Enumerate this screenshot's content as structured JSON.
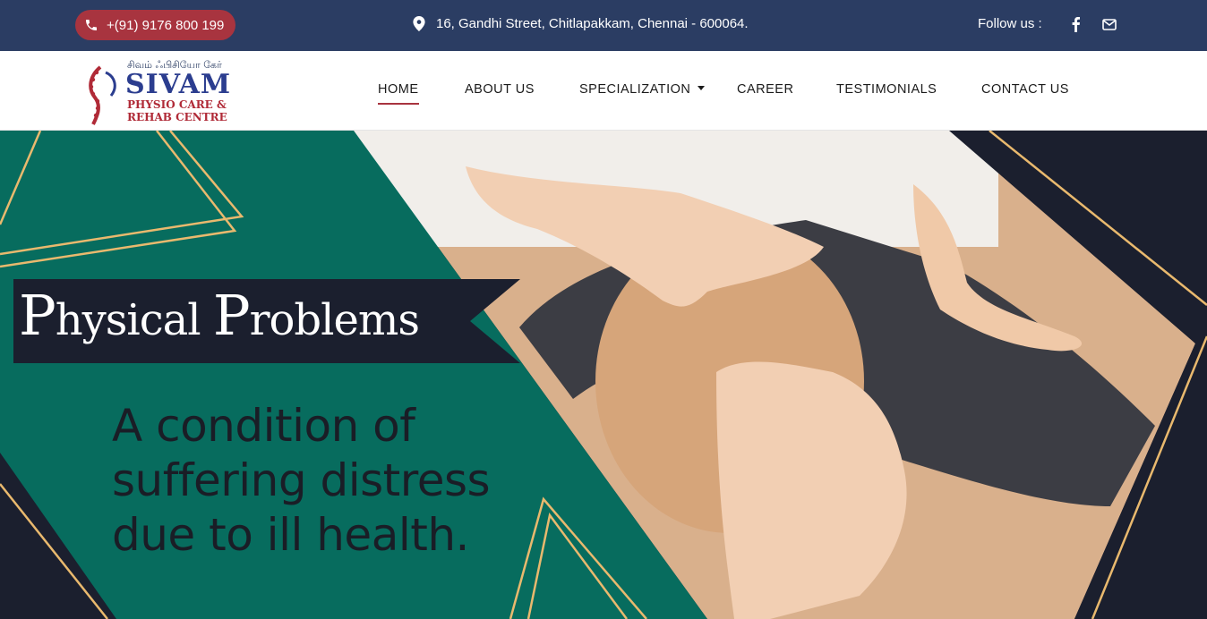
{
  "topbar": {
    "phone": "+(91) 9176 800 199",
    "address": "16, Gandhi Street, Chitlapakkam, Chennai - 600064.",
    "follow_label": "Follow us :",
    "social": [
      {
        "icon": "facebook-icon"
      },
      {
        "icon": "email-icon"
      }
    ]
  },
  "logo": {
    "tamil": "சிவம் ஃபிசியோ கேர்",
    "name": "SIVAM",
    "line1": "PHYSIO CARE &",
    "line2": "REHAB CENTRE"
  },
  "nav": {
    "items": [
      {
        "label": "HOME",
        "active": true
      },
      {
        "label": "ABOUT US"
      },
      {
        "label": "SPECIALIZATION",
        "has_dropdown": true
      },
      {
        "label": "CAREER"
      },
      {
        "label": "TESTIMONIALS"
      },
      {
        "label": "CONTACT US"
      }
    ]
  },
  "hero": {
    "title_p": "P",
    "title_rest1": "hysical ",
    "title_p2": "P",
    "title_rest2": "roblems",
    "tagline": "A condition of suffering distress due to ill health."
  },
  "colors": {
    "topbar": "#2b3d63",
    "accent_red": "#a8343f",
    "hero_green": "#076c5e",
    "hero_dark": "#1b1f2e",
    "line_gold": "#e9b96e"
  }
}
